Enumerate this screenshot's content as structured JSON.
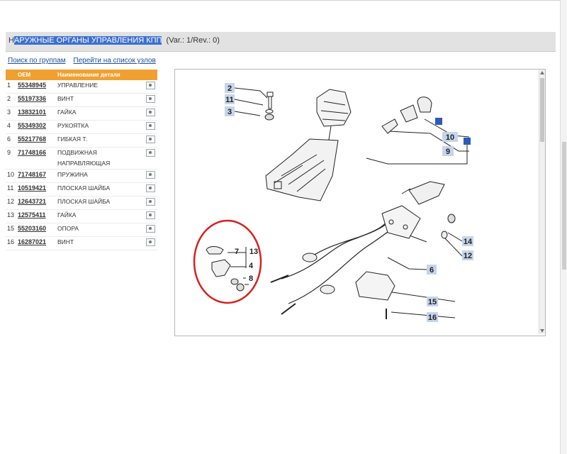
{
  "header": {
    "title_first_letter": "Н",
    "title_selected": "АРУЖНЫЕ ОРГАНЫ УПРАВЛЕНИЯ КПП",
    "title_meta": "(Var.: 1/Rev.: 0)"
  },
  "links": {
    "search_by_groups": "Поиск по группам",
    "go_to_units": "Перейти на список узлов"
  },
  "table": {
    "col_oem": "OEM",
    "col_name": "Наименование детали",
    "rows": [
      {
        "num": "1",
        "oem": "55348945",
        "desc": "УПРАВЛЕНИЕ"
      },
      {
        "num": "2",
        "oem": "55197336",
        "desc": "ВИНТ"
      },
      {
        "num": "3",
        "oem": "13832101",
        "desc": "ГАЙКА"
      },
      {
        "num": "4",
        "oem": "55349302",
        "desc": "РУКОЯТКА"
      },
      {
        "num": "6",
        "oem": "55217768",
        "desc": "ГИБКАЯ Т."
      },
      {
        "num": "9",
        "oem": "71748166",
        "desc": "ПОДВИЖНАЯ НАПРАВЛЯЮЩАЯ"
      },
      {
        "num": "10",
        "oem": "71748167",
        "desc": "ПРУЖИНА"
      },
      {
        "num": "11",
        "oem": "10519421",
        "desc": "ПЛОСКАЯ ШАЙБА"
      },
      {
        "num": "12",
        "oem": "12643721",
        "desc": "ПЛОСКАЯ ШАЙБА"
      },
      {
        "num": "13",
        "oem": "12575411",
        "desc": "ГАЙКА"
      },
      {
        "num": "15",
        "oem": "55203160",
        "desc": "ОПОРА"
      },
      {
        "num": "16",
        "oem": "16287021",
        "desc": "ВИНТ"
      }
    ]
  },
  "diagram": {
    "labels": {
      "l2": "2",
      "l11": "11",
      "l3": "3",
      "l10": "10",
      "l9": "9",
      "l7": "7",
      "l13": "13",
      "l4": "4",
      "l8": "8",
      "l14": "14",
      "l12": "12",
      "l6": "6",
      "l15": "15",
      "l16": "16"
    },
    "colors": {
      "callout_box": "#c5d5ea",
      "blue_marker": "#2a5bb8",
      "highlight_circle": "#d62020"
    }
  },
  "colors": {
    "table_header": "#f0a030",
    "selection": "#3c6fd0",
    "link": "#1a4fa0"
  }
}
